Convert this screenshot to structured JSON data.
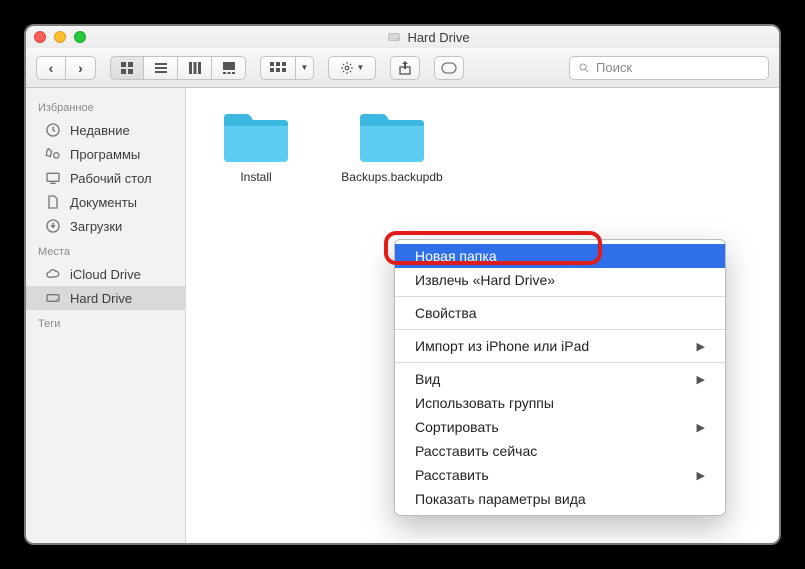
{
  "window": {
    "title": "Hard Drive"
  },
  "toolbar": {
    "search_placeholder": "Поиск"
  },
  "sidebar": {
    "section_favorites": "Избранное",
    "favorites": [
      {
        "icon": "clock",
        "label": "Недавние"
      },
      {
        "icon": "apps",
        "label": "Программы"
      },
      {
        "icon": "desktop",
        "label": "Рабочий стол"
      },
      {
        "icon": "docs",
        "label": "Документы"
      },
      {
        "icon": "downloads",
        "label": "Загрузки"
      }
    ],
    "section_locations": "Места",
    "locations": [
      {
        "icon": "cloud",
        "label": "iCloud Drive",
        "selected": false
      },
      {
        "icon": "disk",
        "label": "Hard Drive",
        "selected": true
      }
    ],
    "section_tags": "Теги"
  },
  "content": {
    "folders": [
      {
        "name": "Install"
      },
      {
        "name": "Backups.backupdb"
      }
    ]
  },
  "context_menu": {
    "items": [
      {
        "label": "Новая папка",
        "highlight": true
      },
      {
        "label": "Извлечь «Hard Drive»"
      },
      {
        "sep": true
      },
      {
        "label": "Свойства"
      },
      {
        "sep": true
      },
      {
        "label": "Импорт из iPhone или iPad",
        "submenu": true
      },
      {
        "sep": true
      },
      {
        "label": "Вид",
        "submenu": true
      },
      {
        "label": "Использовать группы"
      },
      {
        "label": "Сортировать",
        "submenu": true
      },
      {
        "label": "Расставить сейчас"
      },
      {
        "label": "Расставить",
        "submenu": true
      },
      {
        "label": "Показать параметры вида"
      }
    ]
  }
}
